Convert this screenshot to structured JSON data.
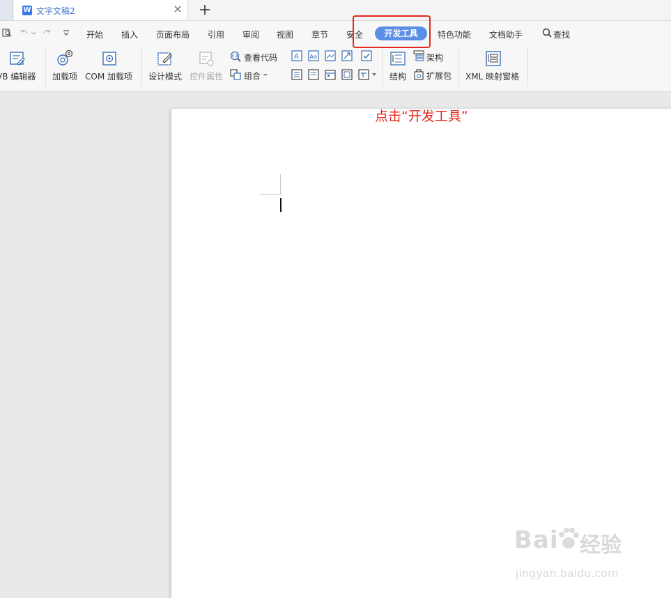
{
  "document": {
    "tab_title": "文字文稿2"
  },
  "menu": {
    "items": [
      "开始",
      "插入",
      "页面布局",
      "引用",
      "审阅",
      "视图",
      "章节",
      "安全",
      "开发工具",
      "特色功能",
      "文档助手",
      "查找"
    ]
  },
  "ribbon": {
    "vb_editor": "VB 编辑器",
    "addins": "加载项",
    "com_addins": "COM 加载项",
    "design_mode": "设计模式",
    "control_props": "控件属性",
    "view_code": "查看代码",
    "group": "组合",
    "structure": "结构",
    "framework": "架构",
    "expansion_pack": "扩展包",
    "xml_pane": "XML 映射窗格"
  },
  "annotation": "点击“开发工具”",
  "watermark": {
    "brand": "Bai",
    "brand_cn": "经验",
    "url": "jingyan.baidu.com"
  },
  "colors": {
    "accent": "#5b8ee6",
    "highlight": "#e5281f",
    "tab_text": "#3b78c9"
  }
}
